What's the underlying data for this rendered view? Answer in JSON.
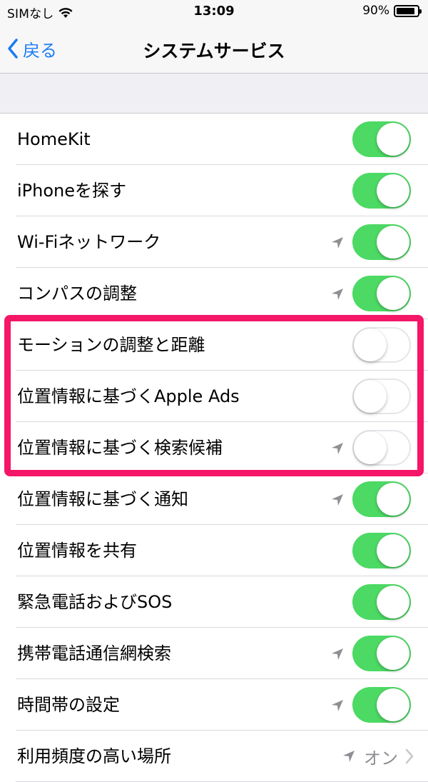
{
  "status_bar": {
    "carrier": "SIMなし",
    "time": "13:09",
    "battery_percent": "90%",
    "battery_level": 0.9
  },
  "nav": {
    "back_label": "戻る",
    "title": "システムサービス"
  },
  "settings": [
    {
      "label": "HomeKit",
      "enabled": true,
      "location_icon": false
    },
    {
      "label": "iPhoneを探す",
      "enabled": true,
      "location_icon": false
    },
    {
      "label": "Wi-Fiネットワーク",
      "enabled": true,
      "location_icon": true
    },
    {
      "label": "コンパスの調整",
      "enabled": true,
      "location_icon": true
    },
    {
      "label": "モーションの調整と距離",
      "enabled": false,
      "location_icon": false
    },
    {
      "label": "位置情報に基づくApple Ads",
      "enabled": false,
      "location_icon": false
    },
    {
      "label": "位置情報に基づく検索候補",
      "enabled": false,
      "location_icon": true
    },
    {
      "label": "位置情報に基づく通知",
      "enabled": true,
      "location_icon": true
    },
    {
      "label": "位置情報を共有",
      "enabled": true,
      "location_icon": false
    },
    {
      "label": "緊急電話およびSOS",
      "enabled": true,
      "location_icon": false
    },
    {
      "label": "携帯電話通信網検索",
      "enabled": true,
      "location_icon": true
    },
    {
      "label": "時間帯の設定",
      "enabled": true,
      "location_icon": true
    },
    {
      "label": "利用頻度の高い場所",
      "value": "オン",
      "location_icon": true,
      "disclosure": true
    }
  ],
  "colors": {
    "toggle_on": "#4cd964",
    "accent": "#1a7cf5",
    "highlight": "#f51668"
  }
}
